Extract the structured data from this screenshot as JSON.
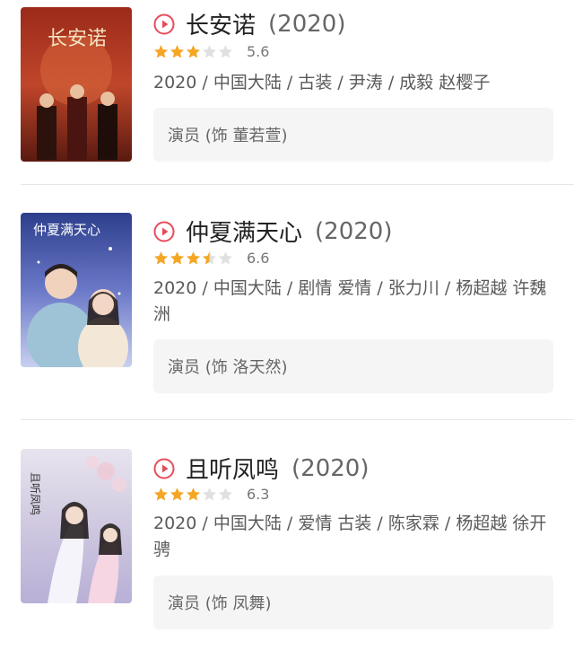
{
  "items": [
    {
      "title": "长安诺",
      "year": "(2020)",
      "rating": 5.6,
      "score_text": "5.6",
      "meta": "2020 / 中国大陆 / 古装 / 尹涛 / 成毅 赵樱子",
      "role": "演员 (饰 董若萱)",
      "poster_text": "长安诺"
    },
    {
      "title": "仲夏满天心",
      "year": "(2020)",
      "rating": 6.6,
      "score_text": "6.6",
      "meta": "2020 / 中国大陆 / 剧情 爱情 / 张力川 / 杨超越 许魏洲",
      "role": "演员 (饰 洛天然)",
      "poster_text": "仲夏满天心"
    },
    {
      "title": "且听凤鸣",
      "year": "(2020)",
      "rating": 6.3,
      "score_text": "6.3",
      "meta": "2020 / 中国大陆 / 爱情 古装 / 陈家霖 / 杨超越 徐开骋",
      "role": "演员 (饰 凤舞)",
      "poster_text": "且听凤鸣"
    }
  ],
  "colors": {
    "star_filled": "#f5a623",
    "star_empty": "#e0e0e0",
    "play_icon": "#e84c5a"
  },
  "icons": {
    "play": "play-circle-icon",
    "star": "star-icon"
  }
}
